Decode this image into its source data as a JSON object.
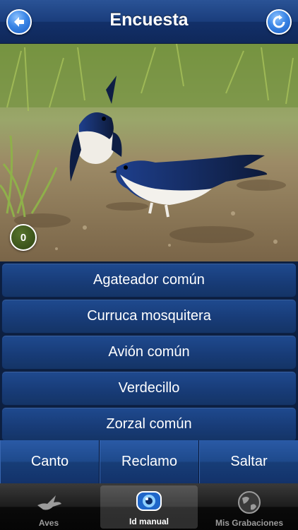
{
  "navbar": {
    "title": "Encuesta",
    "left_icon": "back-arrow-icon",
    "right_icon": "refresh-icon"
  },
  "photo": {
    "counter": "0"
  },
  "answers": [
    "Agateador común",
    "Curruca mosquitera",
    "Avión común",
    "Verdecillo",
    "Zorzal común"
  ],
  "actions": {
    "canto": "Canto",
    "reclamo": "Reclamo",
    "saltar": "Saltar"
  },
  "tabbar": {
    "tabs": [
      {
        "label": "Aves",
        "icon": "bird-icon",
        "active": false
      },
      {
        "label": "Id manual",
        "icon": "eye-icon",
        "active": true
      },
      {
        "label": "Mis Grabaciones",
        "icon": "globe-icon",
        "active": false
      }
    ]
  },
  "colors": {
    "nav_blue": "#1a3d7c",
    "button_blue": "#183c78",
    "counter_green": "#3a521a"
  }
}
